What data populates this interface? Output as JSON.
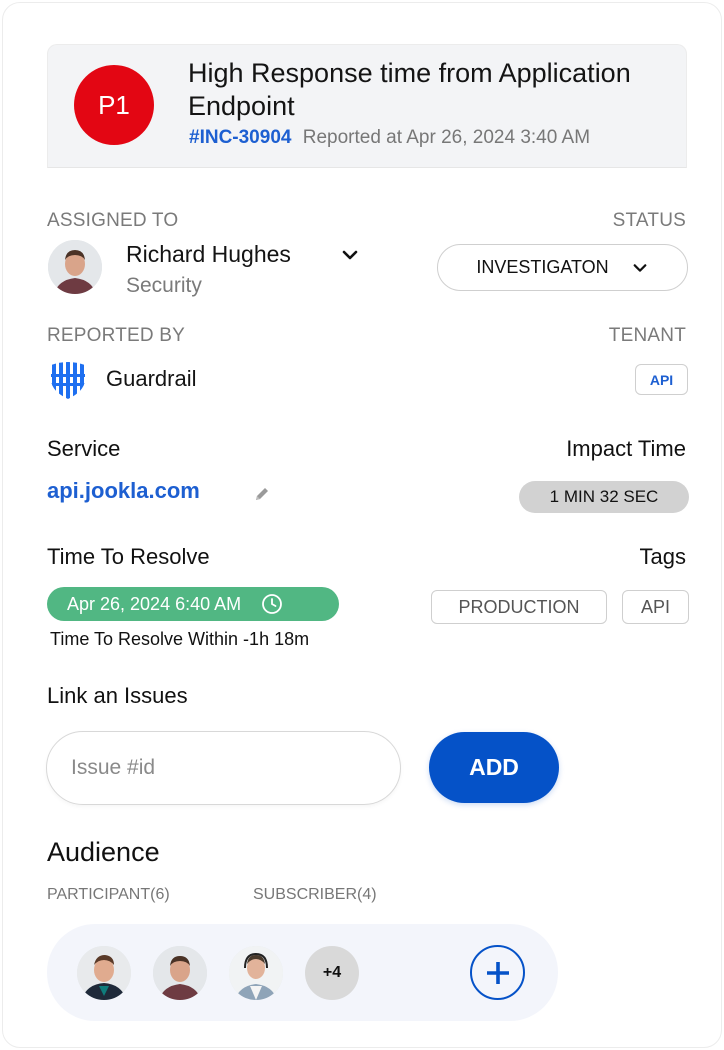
{
  "incident": {
    "priority": "P1",
    "title": "High Response time from Application Endpoint",
    "id": "#INC-30904",
    "reported_at": "Reported at Apr 26, 2024 3:40 AM"
  },
  "assigned": {
    "label": "ASSIGNED TO",
    "name": "Richard Hughes",
    "team": "Security"
  },
  "status": {
    "label": "STATUS",
    "value": "INVESTIGATON"
  },
  "reported_by": {
    "label": "REPORTED BY",
    "name": "Guardrail"
  },
  "tenant": {
    "label": "TENANT",
    "value": "API"
  },
  "service": {
    "label": "Service",
    "value": "api.jookla.com"
  },
  "impact": {
    "label": "Impact Time",
    "value": "1 MIN 32 SEC"
  },
  "resolve": {
    "label": "Time To Resolve",
    "deadline": "Apr 26, 2024 6:40 AM",
    "within_text": "Time To Resolve Within -1h 18m"
  },
  "tags": {
    "label": "Tags",
    "items": [
      "PRODUCTION",
      "API"
    ]
  },
  "link_issue": {
    "label": "Link an Issues",
    "placeholder": "Issue #id",
    "value": "",
    "button": "ADD"
  },
  "audience": {
    "title": "Audience",
    "tabs": [
      "PARTICIPANT(6)",
      "SUBSCRIBER(4)"
    ],
    "more_count": "+4"
  },
  "colors": {
    "priority": "#e30613",
    "link": "#1d5fd1",
    "primary": "#0552c8",
    "resolve_badge": "#51b783"
  }
}
